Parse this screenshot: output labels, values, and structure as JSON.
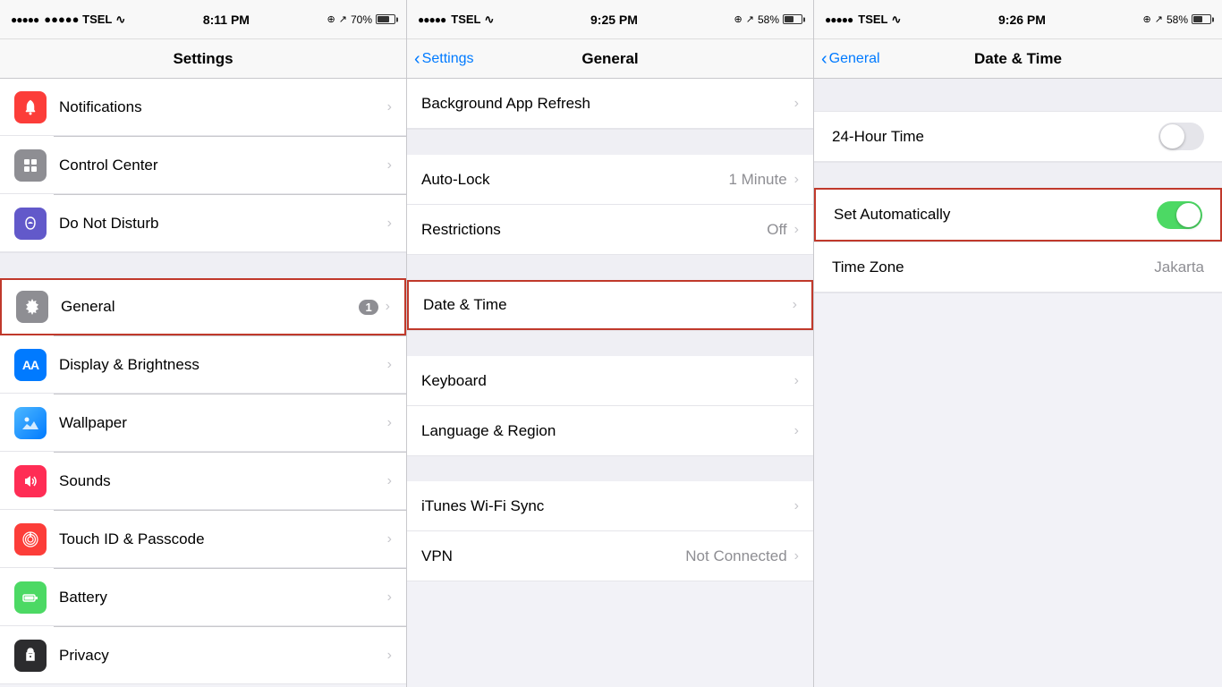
{
  "panels": {
    "left": {
      "statusBar": {
        "carrier": "●●●●● TSEL",
        "wifi": "WiFi",
        "time": "8:11 PM",
        "location": "⊕",
        "arrow": "↗",
        "battery": "70%"
      },
      "navTitle": "Settings",
      "sections": [
        {
          "items": [
            {
              "id": "notifications",
              "label": "Notifications",
              "icon": "🔔",
              "iconBg": "red",
              "badge": null
            },
            {
              "id": "control-center",
              "label": "Control Center",
              "icon": "⊞",
              "iconBg": "gray",
              "badge": null
            },
            {
              "id": "do-not-disturb",
              "label": "Do Not Disturb",
              "icon": "🌙",
              "iconBg": "purple",
              "badge": null
            }
          ]
        },
        {
          "items": [
            {
              "id": "general",
              "label": "General",
              "icon": "⚙",
              "iconBg": "gear",
              "badge": "1",
              "highlighted": true
            },
            {
              "id": "display-brightness",
              "label": "Display & Brightness",
              "icon": "AA",
              "iconBg": "blue",
              "badge": null
            },
            {
              "id": "wallpaper",
              "label": "Wallpaper",
              "icon": "✿",
              "iconBg": "teal",
              "badge": null
            },
            {
              "id": "sounds",
              "label": "Sounds",
              "icon": "🔊",
              "iconBg": "pink",
              "badge": null
            },
            {
              "id": "touch-id",
              "label": "Touch ID & Passcode",
              "icon": "✦",
              "iconBg": "red",
              "badge": null
            },
            {
              "id": "battery",
              "label": "Battery",
              "icon": "▶",
              "iconBg": "green",
              "badge": null
            },
            {
              "id": "privacy",
              "label": "Privacy",
              "icon": "✋",
              "iconBg": "dark",
              "badge": null
            }
          ]
        }
      ]
    },
    "mid": {
      "statusBar": {
        "carrier": "●●●●● TSEL",
        "wifi": "WiFi",
        "time": "9:25 PM",
        "battery": "58%"
      },
      "navBack": "Settings",
      "navTitle": "General",
      "sections": [
        {
          "items": [
            {
              "id": "bg-app-refresh",
              "label": "Background App Refresh",
              "value": "",
              "highlighted": false
            }
          ]
        },
        {
          "items": [
            {
              "id": "auto-lock",
              "label": "Auto-Lock",
              "value": "1 Minute",
              "highlighted": false
            },
            {
              "id": "restrictions",
              "label": "Restrictions",
              "value": "Off",
              "highlighted": false
            }
          ]
        },
        {
          "items": [
            {
              "id": "date-time",
              "label": "Date & Time",
              "value": "",
              "highlighted": true
            }
          ]
        },
        {
          "items": [
            {
              "id": "keyboard",
              "label": "Keyboard",
              "value": "",
              "highlighted": false
            },
            {
              "id": "language-region",
              "label": "Language & Region",
              "value": "",
              "highlighted": false
            }
          ]
        },
        {
          "items": [
            {
              "id": "itunes-wifi",
              "label": "iTunes Wi-Fi Sync",
              "value": "",
              "highlighted": false
            },
            {
              "id": "vpn",
              "label": "VPN",
              "value": "Not Connected",
              "highlighted": false
            }
          ]
        }
      ]
    },
    "right": {
      "statusBar": {
        "carrier": "●●●●● TSEL",
        "wifi": "WiFi",
        "time": "9:26 PM",
        "battery": "58%"
      },
      "navBack": "General",
      "navTitle": "Date & Time",
      "sections": [
        {
          "items": [
            {
              "id": "24-hour-time",
              "label": "24-Hour Time",
              "type": "toggle",
              "value": false
            }
          ]
        },
        {
          "items": [
            {
              "id": "set-automatically",
              "label": "Set Automatically",
              "type": "toggle",
              "value": true,
              "highlighted": true
            }
          ]
        },
        {
          "items": [
            {
              "id": "time-zone",
              "label": "Time Zone",
              "value": "Jakarta",
              "type": "value"
            }
          ]
        }
      ]
    }
  },
  "icons": {
    "notifications": "🔔",
    "control-center": "⊞",
    "do-not-disturb": "🌙",
    "general": "⚙",
    "display-brightness": "AA",
    "wallpaper": "❋",
    "sounds": "♪",
    "touch-id": "◉",
    "battery": "▶",
    "privacy": "✋"
  }
}
